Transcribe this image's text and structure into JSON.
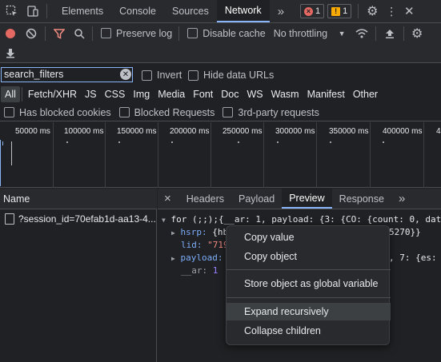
{
  "topbar": {
    "tabs": [
      "Elements",
      "Console",
      "Sources",
      "Network"
    ],
    "active_tab": "Network",
    "more": "»",
    "error_count": "1",
    "warning_count": "1"
  },
  "toolbar": {
    "preserve_log": "Preserve log",
    "disable_cache": "Disable cache",
    "throttling": "No throttling"
  },
  "filter": {
    "value": "search_filters",
    "invert": "Invert",
    "hide_data_urls": "Hide data URLs"
  },
  "types": [
    "All",
    "Fetch/XHR",
    "JS",
    "CSS",
    "Img",
    "Media",
    "Font",
    "Doc",
    "WS",
    "Wasm",
    "Manifest",
    "Other"
  ],
  "blocked": {
    "has_blocked_cookies": "Has blocked cookies",
    "blocked_requests": "Blocked Requests",
    "third_party": "3rd-party requests"
  },
  "timeline": {
    "ticks": [
      "50000 ms",
      "100000 ms",
      "150000 ms",
      "200000 ms",
      "250000 ms",
      "300000 ms",
      "350000 ms",
      "400000 ms",
      "4"
    ]
  },
  "requests": {
    "header": "Name",
    "items": [
      "?session_id=70efab1d-aa13-4..."
    ]
  },
  "detail": {
    "close": "×",
    "tabs": [
      "Headers",
      "Payload",
      "Preview",
      "Response"
    ],
    "active_tab": "Preview",
    "more": "»"
  },
  "preview": {
    "line1": "for (;;);{__ar: 1, payload: {3: {CO: {count: 0, dat",
    "hsrp_key": "hsrp",
    "hsrp_val": "{hb",
    "hsrp_tail": "5270}}",
    "lid_key": "lid",
    "lid_val": "\"719",
    "payload_key": "payload",
    "payload_tail": ", 7: {es: -",
    "ar_key": "__ar",
    "ar_val": "1"
  },
  "context_menu": {
    "items": [
      "Copy value",
      "Copy object",
      "Store object as global variable",
      "Expand recursively",
      "Collapse children"
    ],
    "highlighted": "Expand recursively"
  },
  "colors": {
    "accent": "#8ab4f8",
    "record": "#e46962",
    "filter_icon": "#f28b82",
    "background": "#202124",
    "panel": "#292a2d"
  }
}
